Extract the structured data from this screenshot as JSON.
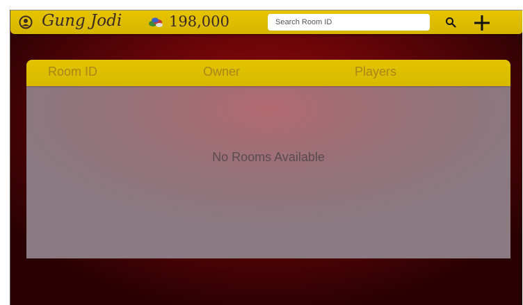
{
  "header": {
    "username": "Gung Jodi",
    "coins": "198,000",
    "search": {
      "placeholder": "Search Room ID"
    }
  },
  "table": {
    "columns": [
      "Room ID",
      "Owner",
      "Players"
    ],
    "empty_message": "No Rooms Available"
  },
  "icons": {
    "user": "user-circle-icon",
    "coins": "coins-icon",
    "search": "search-icon",
    "add": "plus-icon"
  },
  "colors": {
    "accent": "#e2c400",
    "background": "#7a0508",
    "panel": "#96727a"
  }
}
